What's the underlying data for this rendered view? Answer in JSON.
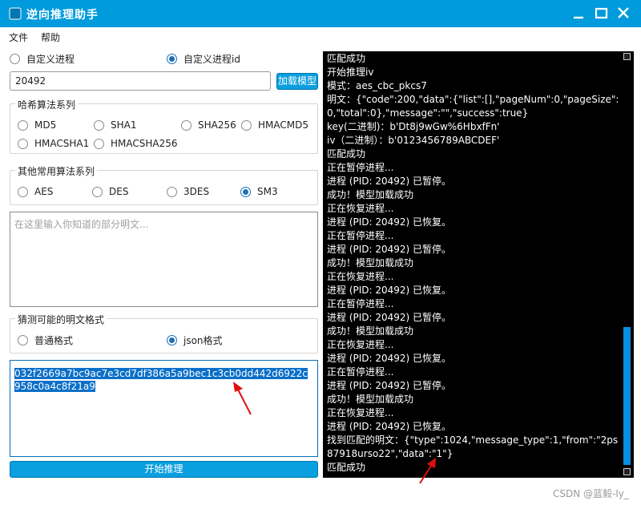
{
  "window": {
    "title": "逆向推理助手",
    "icon": "app-icon",
    "buttons": [
      "minimize-icon",
      "maximize-icon",
      "close-icon"
    ]
  },
  "menu": {
    "file": "文件",
    "help": "帮助"
  },
  "process_select": {
    "custom_process": "自定义进程",
    "custom_process_id": "自定义进程id",
    "selected": "custom_process_id"
  },
  "pid_input": {
    "value": "20492"
  },
  "load_button": "加载模型",
  "hash_group": {
    "title": "哈希算法系列",
    "options": [
      "MD5",
      "SHA1",
      "SHA256",
      "HMACMD5",
      "HMACSHA1",
      "HMACSHA256"
    ]
  },
  "other_group": {
    "title": "其他常用算法系列",
    "options": [
      "AES",
      "DES",
      "3DES",
      "SM3"
    ],
    "selected": "SM3"
  },
  "plaintext_input": {
    "placeholder": "在这里输入你知道的部分明文..."
  },
  "format_group": {
    "title": "猜测可能的明文格式",
    "options": [
      "普通格式",
      "json格式"
    ],
    "selected": "json格式"
  },
  "cipher": {
    "value": "032f2669a7bc9ac7e3cd7df386a5a9bec1c3cb0dd442d6922c958c0a4c8f21a9"
  },
  "start_button": "开始推理",
  "log": {
    "lines": [
      "匹配成功",
      "开始推理iv",
      "模式：aes_cbc_pkcs7",
      "明文：{\"code\":200,\"data\":{\"list\":[],\"pageNum\":0,\"pageSize\":0,\"total\":0},\"message\":\"\",\"success\":true}",
      "key(二进制)：b'Dt8j9wGw%6HbxfFn'",
      "iv（二进制）：b'0123456789ABCDEF'",
      "匹配成功",
      "正在暂停进程...",
      "进程 (PID: 20492) 已暂停。",
      "成功！模型加载成功",
      "正在恢复进程...",
      "进程 (PID: 20492) 已恢复。",
      "正在暂停进程...",
      "进程 (PID: 20492) 已暂停。",
      "成功！模型加载成功",
      "正在恢复进程...",
      "进程 (PID: 20492) 已恢复。",
      "正在暂停进程...",
      "进程 (PID: 20492) 已暂停。",
      "成功！模型加载成功",
      "正在恢复进程...",
      "进程 (PID: 20492) 已恢复。",
      "正在暂停进程...",
      "进程 (PID: 20492) 已暂停。",
      "成功！模型加载成功",
      "正在恢复进程...",
      "进程 (PID: 20492) 已恢复。",
      "找到匹配的明文：{\"type\":1024,\"message_type\":1,\"from\":\"2ps87918urso22\",\"data\":\"1\"}",
      "匹配成功"
    ]
  },
  "watermark": "CSDN @蓝毅-ly_",
  "colors": {
    "titlebar": "#009bdc",
    "accent": "#0a9fdf",
    "arrow": "#e01010",
    "log_bg": "#000000"
  }
}
